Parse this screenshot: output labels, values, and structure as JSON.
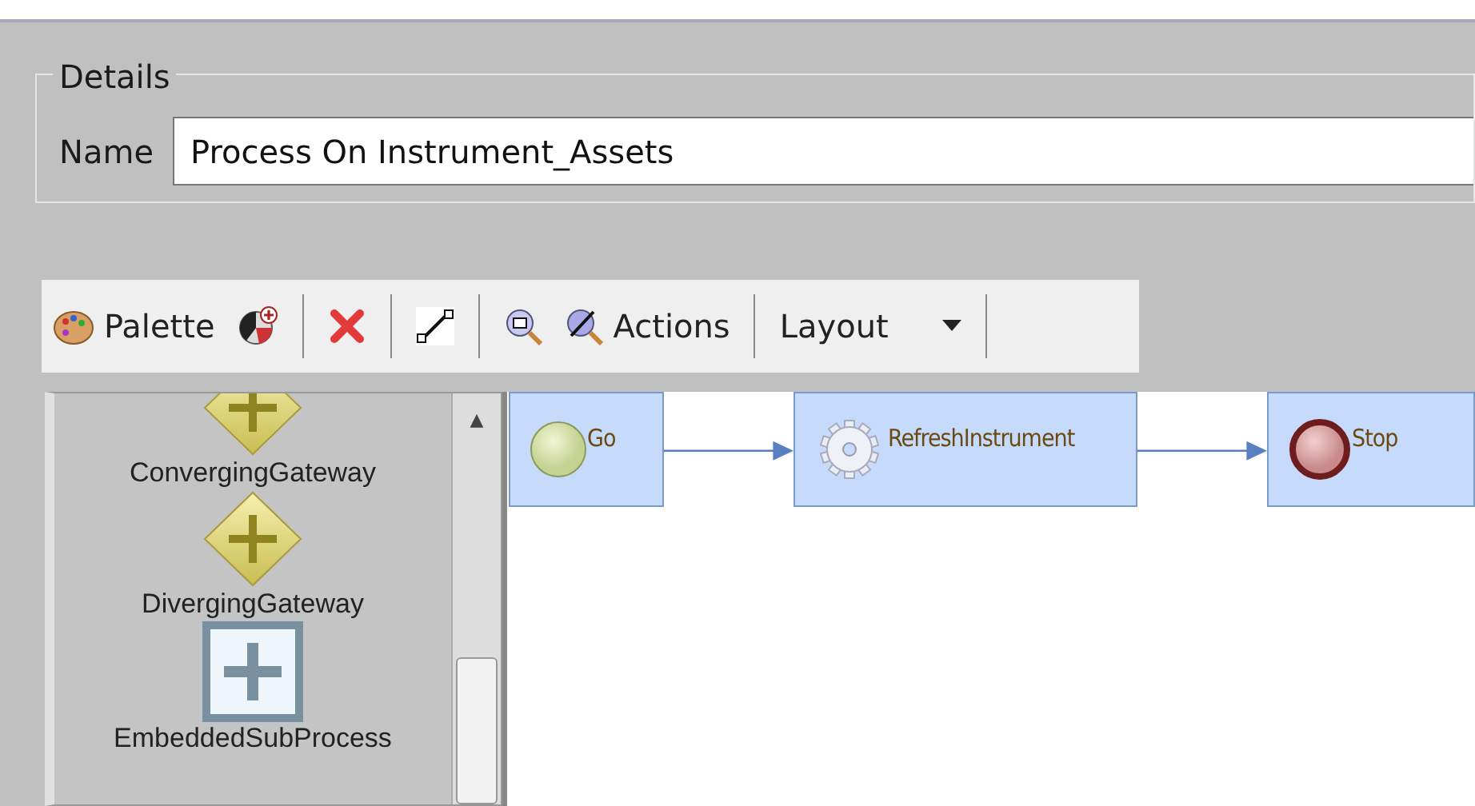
{
  "details": {
    "legend": "Details",
    "name_label": "Name",
    "name_value": "Process On Instrument_Assets"
  },
  "toolbar": [
    {
      "kind": "palette",
      "label": "Palette"
    },
    {
      "kind": "add"
    },
    {
      "kind": "separator"
    },
    {
      "kind": "delete"
    },
    {
      "kind": "separator"
    },
    {
      "kind": "connect"
    },
    {
      "kind": "separator"
    },
    {
      "kind": "zoom"
    },
    {
      "kind": "actions",
      "label": "Actions"
    },
    {
      "kind": "separator"
    },
    {
      "kind": "dropdown",
      "label": "Layout"
    },
    {
      "kind": "separator"
    }
  ],
  "palette": [
    {
      "kind": "gateway",
      "label": "ConvergingGateway"
    },
    {
      "kind": "gateway",
      "label": "DivergingGateway"
    },
    {
      "kind": "subprocess",
      "label": "EmbeddedSubProcess"
    }
  ],
  "scrollbar": {
    "up_arrow": "▲"
  },
  "diagram": {
    "nodes": [
      {
        "kind": "start",
        "label": "Go",
        "arrow_to_next": true
      },
      {
        "kind": "task",
        "label": "RefreshInstrument",
        "arrow_to_next": true
      },
      {
        "kind": "end",
        "label": "Stop",
        "arrow_to_next": false
      }
    ]
  }
}
